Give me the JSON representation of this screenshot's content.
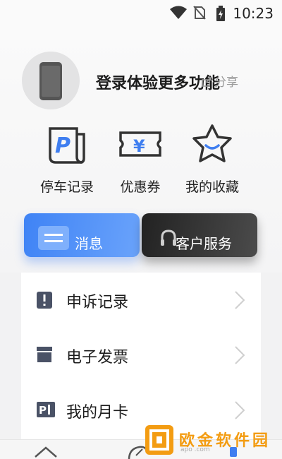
{
  "status_bar": {
    "time": "10:23"
  },
  "profile": {
    "login_prompt": "登录体验更多功能",
    "share_label": "分享"
  },
  "quick_actions": [
    {
      "label": "停车记录",
      "icon": "parking-record-icon"
    },
    {
      "label": "优惠券",
      "icon": "coupon-icon"
    },
    {
      "label": "我的收藏",
      "icon": "star-icon"
    }
  ],
  "cards": {
    "messages_label": "消息",
    "service_label": "客户服务"
  },
  "menu": [
    {
      "label": "申诉记录",
      "icon": "alert-doc-icon"
    },
    {
      "label": "电子发票",
      "icon": "invoice-icon"
    },
    {
      "label": "我的月卡",
      "icon": "monthly-card-icon"
    }
  ],
  "watermark": {
    "text": "欧金软件园",
    "sub": "apo    .com"
  },
  "colors": {
    "accent_blue": "#3f83f5",
    "dark_card": "#2a2a2a",
    "icon_blue": "#3f7ef0"
  }
}
